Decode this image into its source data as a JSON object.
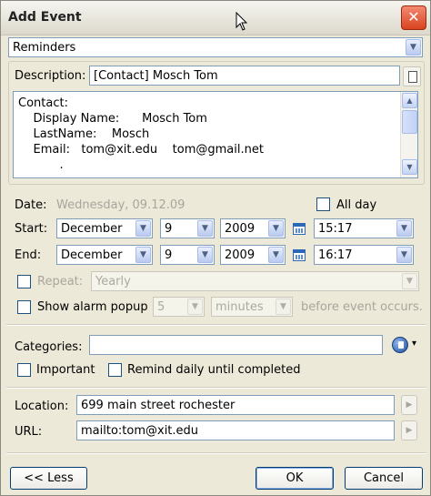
{
  "window": {
    "title": "Add Event",
    "close_glyph": "✕"
  },
  "category_select": {
    "value": "Reminders"
  },
  "description": {
    "label": "Description:",
    "value": "[Contact] Mosch Tom",
    "body_lines": [
      "Contact:",
      "    Display Name:      Mosch Tom",
      "    LastName:    Mosch",
      "    Email:   tom@xit.edu    tom@gmail.net",
      "           ."
    ]
  },
  "date": {
    "label": "Date:",
    "value": "Wednesday, 09.12.09",
    "all_day_label": "All day"
  },
  "start": {
    "label": "Start:",
    "month": "December",
    "day": "9",
    "year": "2009",
    "time": "15:17"
  },
  "end": {
    "label": "End:",
    "month": "December",
    "day": "9",
    "year": "2009",
    "time": "16:17"
  },
  "repeat": {
    "label": "Repeat:",
    "value": "Yearly"
  },
  "alarm": {
    "label": "Show alarm popup",
    "amount": "5",
    "unit": "minutes",
    "suffix": "before event occurs."
  },
  "categories": {
    "label": "Categories:",
    "value": ""
  },
  "flags": {
    "important_label": "Important",
    "remind_label": "Remind daily until completed"
  },
  "location": {
    "label": "Location:",
    "value": "699 main street rochester"
  },
  "url": {
    "label": "URL:",
    "value": "mailto:tom@xit.edu"
  },
  "buttons": {
    "less": "<< Less",
    "ok": "OK",
    "cancel": "Cancel"
  },
  "glyphs": {
    "dropdown": "▼",
    "scroll_up": "▲",
    "scroll_down": "▼",
    "go": "▶",
    "cat_menu": "▾"
  }
}
